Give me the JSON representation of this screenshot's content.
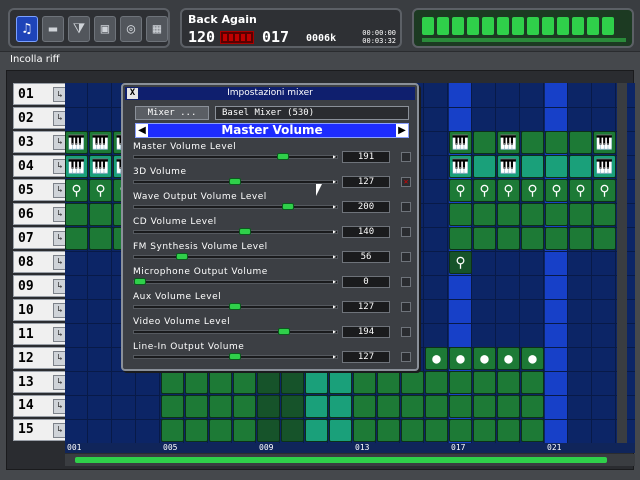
{
  "toolbar": {
    "buttons": [
      {
        "icon": "songs-icon",
        "glyph": "♫"
      },
      {
        "icon": "monitor-icon",
        "glyph": "▬"
      },
      {
        "icon": "funnel-icon",
        "glyph": "⧩"
      },
      {
        "icon": "disk-icon",
        "glyph": "▣"
      },
      {
        "icon": "cd-icon",
        "glyph": "◎"
      },
      {
        "icon": "grid-icon",
        "glyph": "▦"
      }
    ]
  },
  "song": {
    "title": "Back Again",
    "tempo": "120",
    "position": "017",
    "memory": "0006k",
    "time_top": "00:00:00",
    "time_bottom": "00:03:32"
  },
  "status": {
    "text": "Incolla riff"
  },
  "tracks": [
    "01",
    "02",
    "03",
    "04",
    "05",
    "06",
    "07",
    "08",
    "09",
    "10",
    "11",
    "12",
    "13",
    "14",
    "15"
  ],
  "ruler": [
    "001",
    "005",
    "009",
    "013",
    "017",
    "021"
  ],
  "dialog": {
    "title": "Impostazioni mixer",
    "close": "X",
    "mixer_button": "Mixer ...",
    "mixer_name": "Basel Mixer (530)",
    "master_label": "Master Volume",
    "controls": [
      {
        "label": "Master Volume Level",
        "value": "191",
        "level": 0.75,
        "checked": false
      },
      {
        "label": "3D Volume",
        "value": "127",
        "level": 0.5,
        "checked": true
      },
      {
        "label": "Wave Output Volume Level",
        "value": "200",
        "level": 0.78,
        "checked": false
      },
      {
        "label": "CD Volume Level",
        "value": "140",
        "level": 0.55,
        "checked": false
      },
      {
        "label": "FM Synthesis Volume Level",
        "value": "56",
        "level": 0.22,
        "checked": false
      },
      {
        "label": "Microphone Output Volume",
        "value": "0",
        "level": 0.0,
        "checked": false
      },
      {
        "label": "Aux Volume Level",
        "value": "127",
        "level": 0.5,
        "checked": false
      },
      {
        "label": "Video Volume Level",
        "value": "194",
        "level": 0.76,
        "checked": false
      },
      {
        "label": "Line-In Output Volume",
        "value": "127",
        "level": 0.5,
        "checked": false
      }
    ]
  },
  "colors": {
    "accent": "#1d2cff",
    "led_green": "#2fd04a",
    "grid_bg": "#0c2566"
  }
}
